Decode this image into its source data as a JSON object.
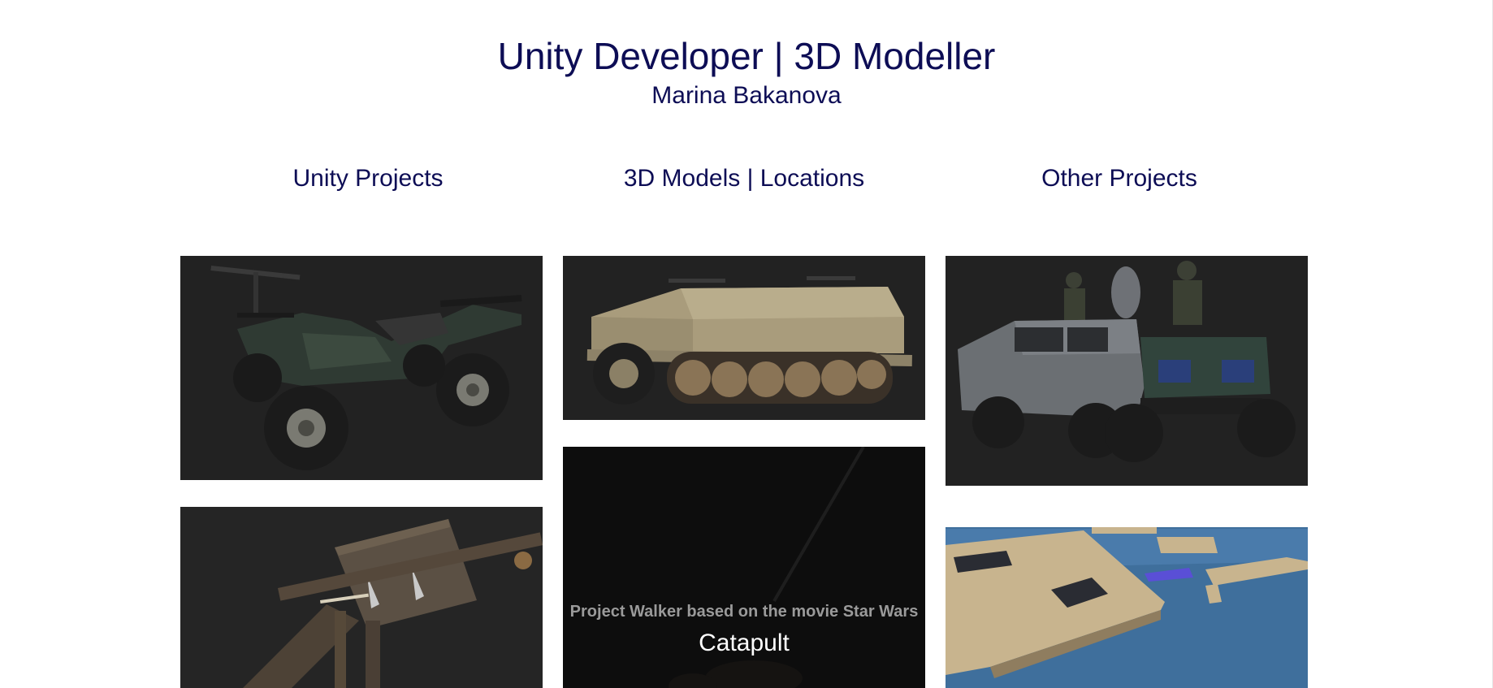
{
  "header": {
    "title": "Unity Developer | 3D Modeller",
    "name": "Marina Bakanova"
  },
  "nav": {
    "items": [
      {
        "label": "Unity Projects"
      },
      {
        "label": "3D Models | Locations"
      },
      {
        "label": "Other Projects"
      }
    ]
  },
  "gallery": {
    "hover_card": {
      "description": "Project Walker based on the movie Star Wars",
      "title": "Catapult"
    }
  },
  "colors": {
    "heading": "#0d0d55",
    "card_background": "#222222",
    "hover_background": "#0d0d0d"
  }
}
